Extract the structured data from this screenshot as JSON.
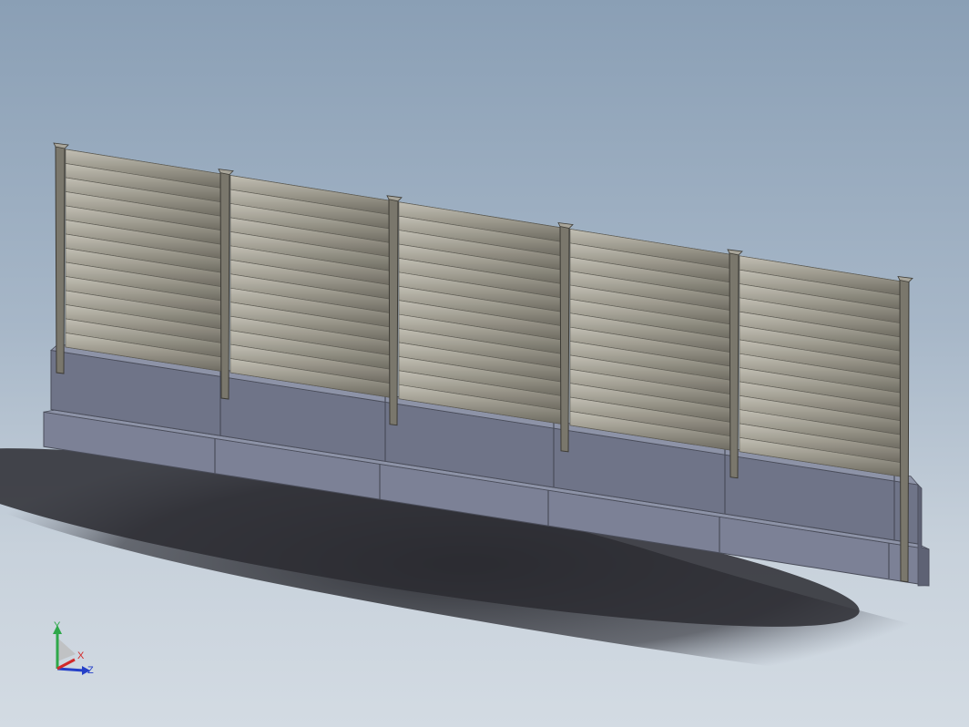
{
  "viewport": {
    "background_top": "#8a9fb5",
    "background_bottom": "#d3dbe3",
    "model": {
      "name": "noise-barrier-fence",
      "posts": 6,
      "panels": 5,
      "colors": {
        "panel": "#8f8c80",
        "panel_highlight": "#b6b3a8",
        "post": "#7a776c",
        "barrier_face": "#6f7488",
        "barrier_top": "#8d93a7",
        "barrier_base": "#7c8196",
        "shadow": "#2b2c31"
      }
    },
    "triad": {
      "x_label": "X",
      "y_label": "Y",
      "z_label": "Z",
      "x_color": "#d22a2a",
      "y_color": "#2ea84a",
      "z_color": "#2540c8"
    }
  }
}
